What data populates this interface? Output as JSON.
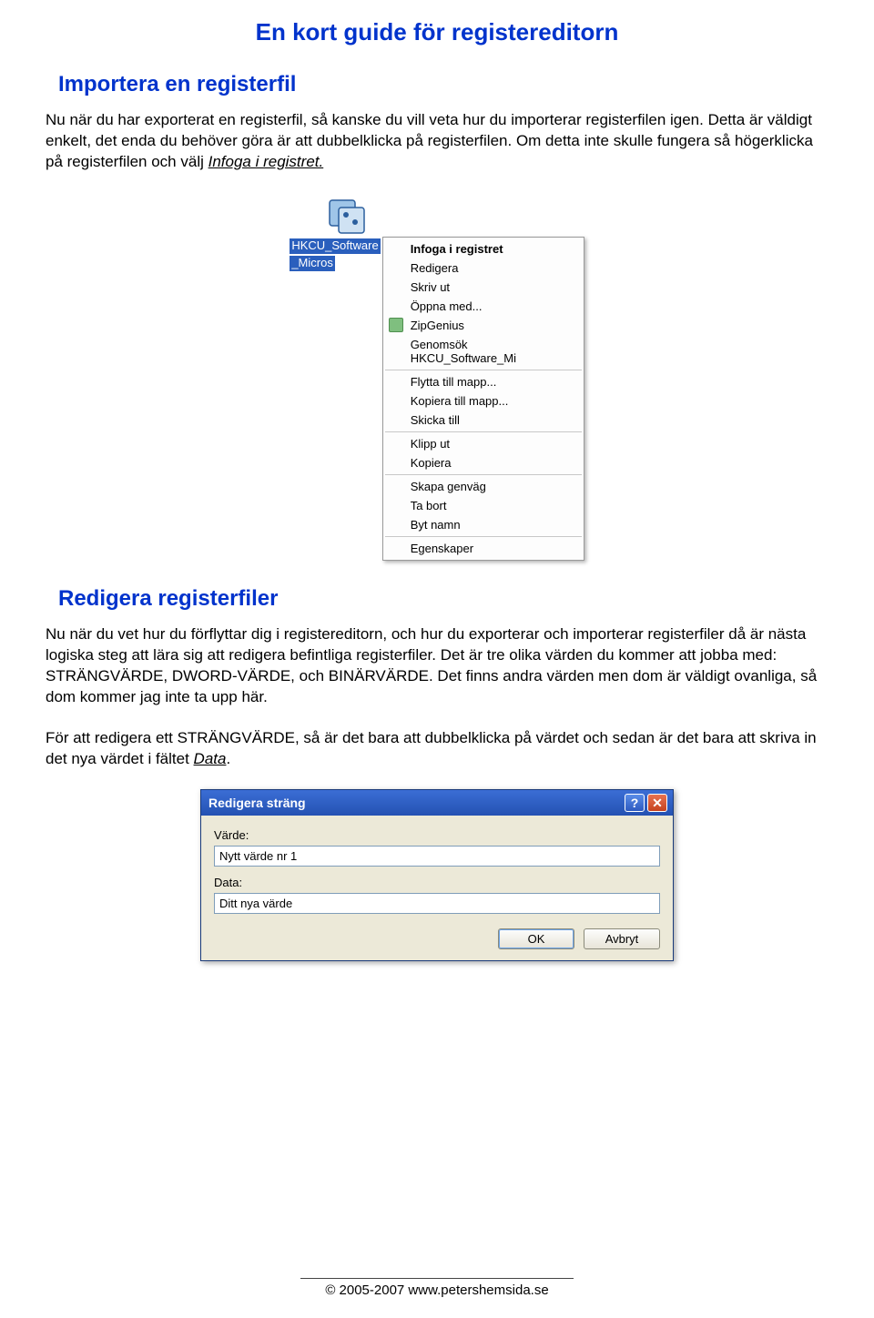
{
  "title": "En kort guide för registereditorn",
  "section1": {
    "heading": "Importera en registerfil",
    "para_pre": "Nu när du har exporterat en registerfil, så kanske du vill veta hur du importerar registerfilen igen. Detta är väldigt enkelt, det enda du behöver göra är att dubbelklicka på registerfilen. Om detta inte skulle fungera så högerklicka på registerfilen och välj ",
    "para_em": "Infoga i registret.",
    "icon_label_line1": "HKCU_Software",
    "icon_label_line2": "_Micros"
  },
  "context_menu": {
    "items": [
      {
        "label": "Infoga i registret",
        "bold": true
      },
      {
        "label": "Redigera"
      },
      {
        "label": "Skriv ut"
      },
      {
        "label": "Öppna med..."
      },
      {
        "label": "ZipGenius",
        "icon": true
      },
      {
        "label": "Genomsök HKCU_Software_Mi"
      },
      {
        "sep": true
      },
      {
        "label": "Flytta till mapp..."
      },
      {
        "label": "Kopiera till mapp..."
      },
      {
        "label": "Skicka till"
      },
      {
        "sep": true
      },
      {
        "label": "Klipp ut"
      },
      {
        "label": "Kopiera"
      },
      {
        "sep": true
      },
      {
        "label": "Skapa genväg"
      },
      {
        "label": "Ta bort"
      },
      {
        "label": "Byt namn"
      },
      {
        "sep": true
      },
      {
        "label": "Egenskaper"
      }
    ]
  },
  "section2": {
    "heading": "Redigera registerfiler",
    "para1": "Nu när du vet hur du förflyttar dig i registereditorn, och hur du exporterar och importerar registerfiler då är nästa logiska steg att lära sig att redigera befintliga registerfiler. Det är tre olika värden du kommer att jobba med: STRÄNGVÄRDE, DWORD-VÄRDE, och BINÄRVÄRDE. Det finns andra värden men dom är väldigt ovanliga, så dom kommer jag inte ta upp här.",
    "para2_pre": "För att redigera ett STRÄNGVÄRDE, så är det bara att dubbelklicka på värdet och sedan är det bara att skriva in det nya värdet i fältet ",
    "para2_em": "Data",
    "para2_post": "."
  },
  "dialog": {
    "title": "Redigera sträng",
    "label_value": "Värde:",
    "input_value": "Nytt värde nr 1",
    "label_data": "Data:",
    "input_data": "Ditt nya värde",
    "ok": "OK",
    "cancel": "Avbryt"
  },
  "footer": "© 2005-2007 www.petershemsida.se"
}
